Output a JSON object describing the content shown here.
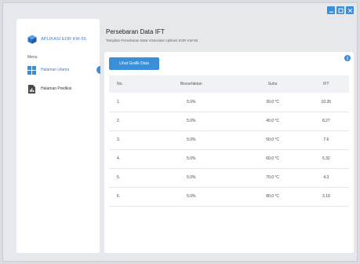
{
  "app": {
    "name": "APLIKASI EOR KW-55"
  },
  "sidebar": {
    "menu_label": "Menu",
    "items": [
      {
        "label": "Halaman Utama",
        "icon": "dashboard-grid-icon",
        "active": true
      },
      {
        "label": "Halaman Prediksi",
        "icon": "document-chart-icon",
        "active": false
      }
    ]
  },
  "header": {
    "title": "Persebaran Data IFT",
    "subtitle": "Tampilan Persebaran Data Viskositas Aplikasi EOR KW-55"
  },
  "toolbar": {
    "chart_button_label": "Lihat Grafik Data"
  },
  "table": {
    "columns": [
      "No.",
      "Biosurfaktan",
      "Suhu",
      "IFT"
    ],
    "rows": [
      [
        "1.",
        "5.0%",
        "30.0 °C",
        "10.35"
      ],
      [
        "2.",
        "5.0%",
        "40.0 °C",
        "8.27"
      ],
      [
        "3.",
        "5.0%",
        "50.0 °C",
        "7.6"
      ],
      [
        "4.",
        "5.0%",
        "60.0 °C",
        "5.32"
      ],
      [
        "5.",
        "5.0%",
        "70.0 °C",
        "4.3"
      ],
      [
        "6.",
        "5.0%",
        "80.0 °C",
        "3.19"
      ]
    ]
  },
  "colors": {
    "accent": "#3b8fd8",
    "brand_text": "#3b7fd0"
  }
}
